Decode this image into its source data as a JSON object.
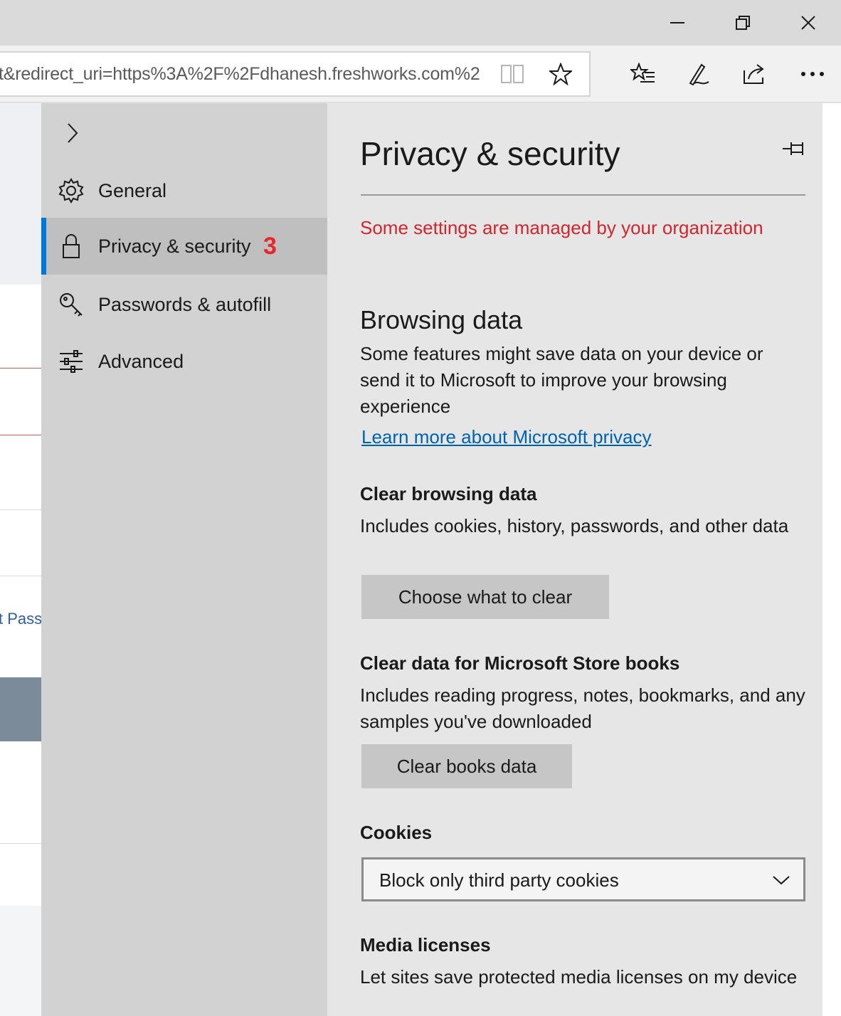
{
  "browser": {
    "address_url": "t&redirect_uri=https%3A%2F%2Fdhanesh.freshworks.com%2",
    "icons": [
      "minimize-icon",
      "restore-icon",
      "close-icon",
      "reading-view-icon",
      "favorite-star-icon",
      "favorites-hub-icon",
      "web-note-icon",
      "share-icon",
      "more-icon"
    ]
  },
  "background_page": {
    "link_fragment": "t Pass"
  },
  "nav": {
    "items": [
      {
        "label": "General",
        "icon": "gear-icon"
      },
      {
        "label": "Privacy & security",
        "icon": "lock-icon",
        "badge": "3",
        "selected": true
      },
      {
        "label": "Passwords & autofill",
        "icon": "key-icon"
      },
      {
        "label": "Advanced",
        "icon": "sliders-icon"
      }
    ]
  },
  "pane": {
    "title": "Privacy & security",
    "managed_notice": "Some settings are managed by your organization",
    "browsing": {
      "heading": "Browsing data",
      "description": "Some features might save data on your device or send it to Microsoft to improve your browsing experience",
      "link": "Learn more about Microsoft privacy"
    },
    "clear_browsing": {
      "heading": "Clear browsing data",
      "description": "Includes cookies, history, passwords, and other data",
      "button": "Choose what to clear"
    },
    "clear_books": {
      "heading": "Clear data for Microsoft Store books",
      "description": "Includes reading progress, notes, bookmarks, and any samples you've downloaded",
      "button": "Clear books data"
    },
    "cookies": {
      "heading": "Cookies",
      "selected": "Block only third party cookies"
    },
    "media": {
      "heading": "Media licenses",
      "description": "Let sites save protected media licenses on my device"
    }
  },
  "colors": {
    "accent": "#0078d7",
    "managed_text": "#d0262d",
    "badge": "#e8262c",
    "link": "#0063b1"
  }
}
